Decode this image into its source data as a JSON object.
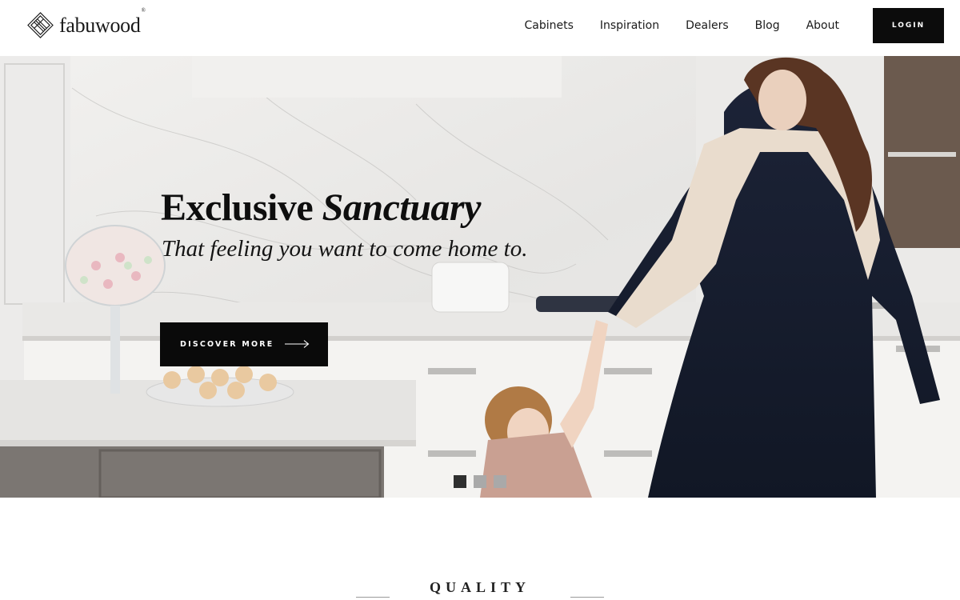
{
  "brand": {
    "name": "fabuwood",
    "reg": "®"
  },
  "nav": {
    "items": [
      {
        "label": "Cabinets"
      },
      {
        "label": "Inspiration"
      },
      {
        "label": "Dealers"
      },
      {
        "label": "Blog"
      },
      {
        "label": "About"
      }
    ],
    "login_label": "LOGIN"
  },
  "hero": {
    "title_plain": "Exclusive",
    "title_italic": "Sanctuary",
    "subtitle": "That feeling you want to come home to.",
    "cta_label": "DISCOVER MORE",
    "cta_icon": "arrow-right-icon",
    "slides_total": 3,
    "active_slide": 1
  },
  "section": {
    "title": "QUALITY"
  },
  "colors": {
    "primary": "#0a0a0a",
    "background": "#ffffff",
    "dot_inactive": "#a9a9a9",
    "dot_active": "#2f2f2f"
  }
}
